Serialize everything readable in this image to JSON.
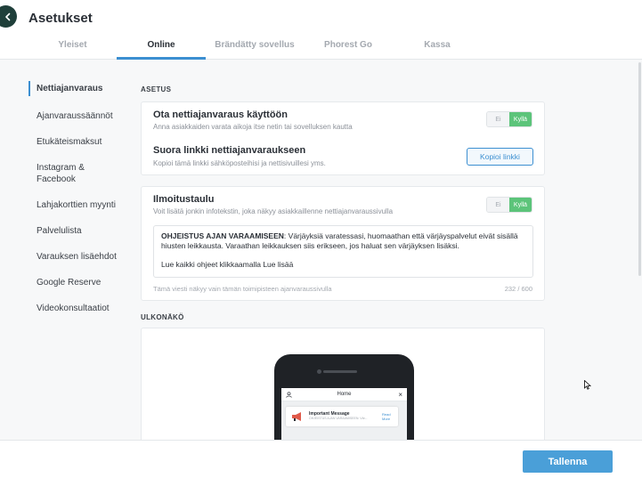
{
  "header": {
    "title": "Asetukset",
    "tabs": [
      {
        "label": "Yleiset"
      },
      {
        "label": "Online"
      },
      {
        "label": "Brändätty sovellus"
      },
      {
        "label": "Phorest Go"
      },
      {
        "label": "Kassa"
      }
    ],
    "active_tab": "Online"
  },
  "sidebar": {
    "items": [
      {
        "label": "Nettiajanvaraus"
      },
      {
        "label": "Ajanvaraussäännöt"
      },
      {
        "label": "Etukäteismaksut"
      },
      {
        "label": "Instagram & Facebook"
      },
      {
        "label": "Lahjakorttien myynti"
      },
      {
        "label": "Palvelulista"
      },
      {
        "label": "Varauksen lisäehdot"
      },
      {
        "label": "Google Reserve"
      },
      {
        "label": "Videokonsultaatiot"
      }
    ]
  },
  "settings": {
    "section_label": "ASETUS",
    "online_booking": {
      "title": "Ota nettiajanvaraus käyttöön",
      "subtitle": "Anna asiakkaiden varata aikoja itse netin tai sovelluksen kautta",
      "toggle_off": "Ei",
      "toggle_on": "Kyllä"
    },
    "direct_link": {
      "title": "Suora linkki nettiajanvaraukseen",
      "subtitle": "Kopioi tämä linkki sähköposteihisi ja nettisivuillesi yms.",
      "button": "Kopioi linkki"
    }
  },
  "notice_board": {
    "title": "Ilmoitustaulu",
    "subtitle": "Voit lisätä jonkin infotekstin, joka näkyy asiakkaillenne nettiajanvaraussivulla",
    "toggle_off": "Ei",
    "toggle_on": "Kyllä",
    "text_bold": "OHJEISTUS AJAN VARAAMISEEN",
    "text_body": ": Värjäyksiä varatessasi, huomaathan että värjäyspalvelut eivät sisällä hiusten leikkausta. Varaathan leikkauksen siis erikseen, jos haluat sen värjäyksen lisäksi.",
    "text_line2": "Lue kaikki ohjeet klikkaamalla Lue lisää",
    "hint": "Tämä viesti näkyy vain tämän toimipisteen ajanvaraussivulla",
    "counter": "232 / 600"
  },
  "appearance": {
    "section_label": "ULKONÄKÖ",
    "phone": {
      "title": "Home",
      "message_title": "Important Message",
      "message_sub": "OHJEISTUS AJAN VARAAMISEEN: Vär...",
      "read_more": "Read More"
    }
  },
  "footer": {
    "save": "Tallenna"
  },
  "colors": {
    "accent": "#3c8fd1",
    "toggle_on": "#5cc47a",
    "save_button": "#4a9fd8",
    "back_button": "#1f3f3a"
  }
}
